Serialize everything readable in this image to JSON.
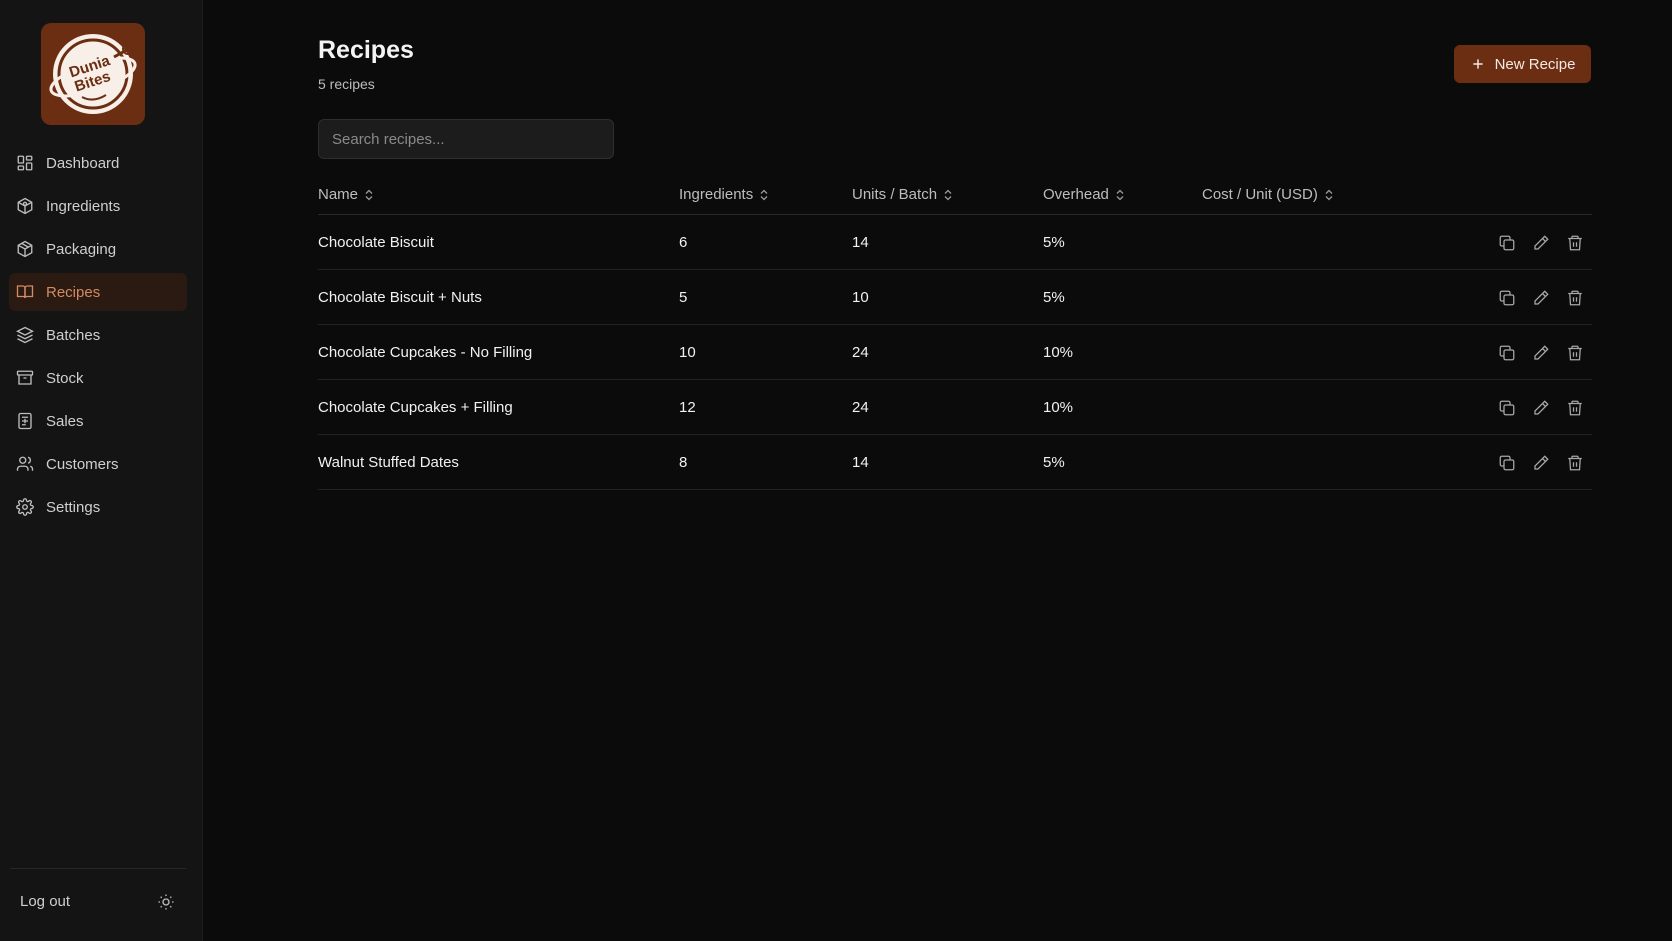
{
  "app": {
    "brand_primary": "#6b2e13",
    "active_accent": "#d28b62"
  },
  "sidebar": {
    "logo_text": "Dunia Bites",
    "items": [
      {
        "label": "Dashboard",
        "icon": "dashboard-icon"
      },
      {
        "label": "Ingredients",
        "icon": "ingredients-icon"
      },
      {
        "label": "Packaging",
        "icon": "box-icon"
      },
      {
        "label": "Recipes",
        "icon": "book-icon",
        "active": true
      },
      {
        "label": "Batches",
        "icon": "layers-icon"
      },
      {
        "label": "Stock",
        "icon": "archive-icon"
      },
      {
        "label": "Sales",
        "icon": "receipt-icon"
      },
      {
        "label": "Customers",
        "icon": "users-icon"
      },
      {
        "label": "Settings",
        "icon": "gear-icon"
      }
    ],
    "logout_label": "Log out",
    "theme_icon": "sun-icon"
  },
  "header": {
    "title": "Recipes",
    "subtitle": "5 recipes",
    "new_button_label": "New Recipe",
    "new_button_icon": "plus-icon"
  },
  "search": {
    "placeholder": "Search recipes...",
    "value": ""
  },
  "table": {
    "columns": [
      "Name",
      "Ingredients",
      "Units / Batch",
      "Overhead",
      "Cost / Unit (USD)"
    ],
    "rows": [
      {
        "name": "Chocolate Biscuit",
        "ingredients": "6",
        "units": "14",
        "overhead": "5%",
        "cost": ""
      },
      {
        "name": "Chocolate Biscuit + Nuts",
        "ingredients": "5",
        "units": "10",
        "overhead": "5%",
        "cost": ""
      },
      {
        "name": "Chocolate Cupcakes - No Filling",
        "ingredients": "10",
        "units": "24",
        "overhead": "10%",
        "cost": ""
      },
      {
        "name": "Chocolate Cupcakes + Filling",
        "ingredients": "12",
        "units": "24",
        "overhead": "10%",
        "cost": ""
      },
      {
        "name": "Walnut Stuffed Dates",
        "ingredients": "8",
        "units": "14",
        "overhead": "5%",
        "cost": ""
      }
    ],
    "row_actions": [
      "copy-icon",
      "edit-icon",
      "trash-icon"
    ]
  }
}
